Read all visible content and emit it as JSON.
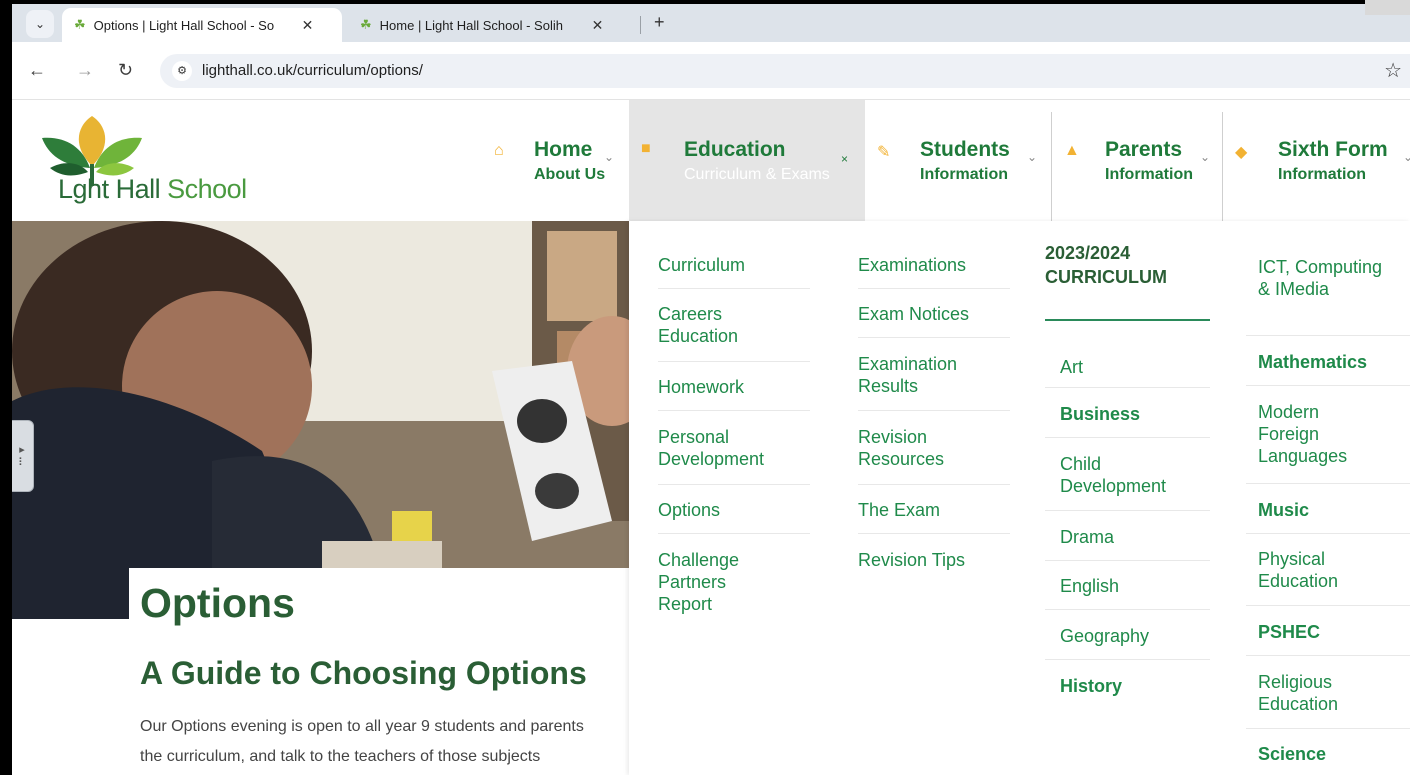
{
  "browser": {
    "tabs": [
      {
        "title": "Options | Light Hall School - So",
        "active": true
      },
      {
        "title": "Home | Light Hall School - Solih",
        "active": false
      }
    ],
    "new_tab": "+",
    "url": "lighthall.co.uk/curriculum/options/"
  },
  "site": {
    "logo_text_1": "L",
    "logo_text_2": "ght Hall",
    "logo_text_3": " School",
    "nav": [
      {
        "main": "Home",
        "sub": "About Us",
        "icon": "home-icon"
      },
      {
        "main": "Education",
        "sub": "Curriculum & Exams",
        "icon": "book-icon"
      },
      {
        "main": "Students",
        "sub": "Information",
        "icon": "pen-icon"
      },
      {
        "main": "Parents",
        "sub": "Information",
        "icon": "person-icon"
      },
      {
        "main": "Sixth Form",
        "sub": "Information",
        "icon": "graduation-cap-icon"
      }
    ]
  },
  "menu": {
    "col1": [
      "Curriculum",
      "Careers Education",
      "Homework",
      "Personal Development",
      "Options",
      "Challenge Partners Report"
    ],
    "col2": [
      "Examinations",
      "Exam Notices",
      "Examination Results",
      "Revision Resources",
      "The Exam",
      "Revision Tips"
    ],
    "col3_heading": "2023/2024 CURRICULUM",
    "col3": [
      "Art",
      "Business",
      "Child Development",
      "Drama",
      "English",
      "Geography",
      "History"
    ],
    "col4": [
      "ICT, Computing & IMedia",
      "Mathematics",
      "Modern Foreign Languages",
      "Music",
      "Physical Education",
      "PSHEC",
      "Religious Education",
      "Science"
    ]
  },
  "page": {
    "title": "Options",
    "subtitle": "A Guide to Choosing Options",
    "body_line_1": "Our Options evening is open to all year 9 students and parents",
    "body_line_2": "the curriculum, and talk to the teachers of those subjects"
  },
  "colors": {
    "brand_green": "#1f7a3a",
    "heading_green": "#2a5e35",
    "link_green": "#1f8a4a",
    "accent_yellow": "#f2b233"
  }
}
